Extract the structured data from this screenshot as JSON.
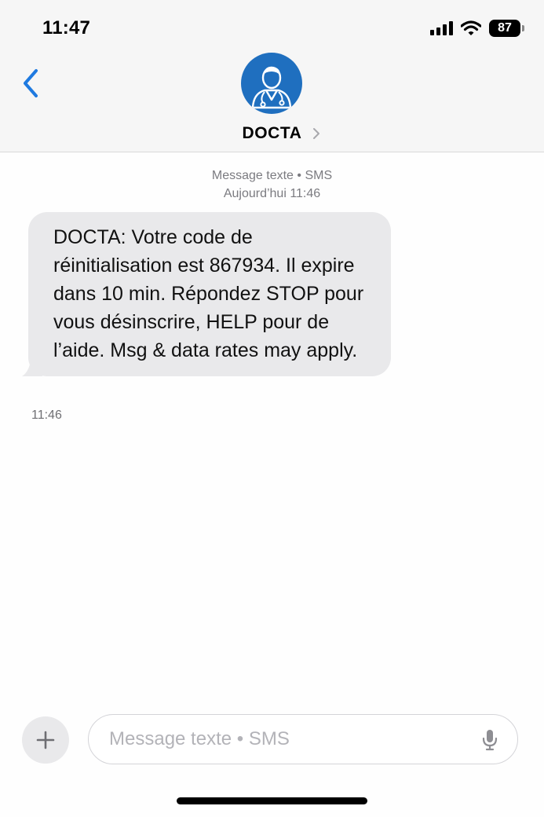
{
  "status_bar": {
    "time": "11:47",
    "battery": "87",
    "icons": [
      "signal-icon",
      "wifi-icon",
      "battery-icon"
    ]
  },
  "header": {
    "back_icon": "chevron-left-icon",
    "avatar_icon": "doctor-icon",
    "contact_name": "DOCTA",
    "details_icon": "chevron-right-icon"
  },
  "thread": {
    "meta_line1": "Message texte • SMS",
    "meta_line2": "Aujourd’hui 11:46",
    "messages": [
      {
        "direction": "incoming",
        "text": "DOCTA: Votre code de réinitialisation est 867934. Il expire dans 10 min. Répondez STOP pour vous désinscrire, HELP pour de l’aide. Msg & data rates may apply.",
        "time": "11:46"
      }
    ]
  },
  "composer": {
    "plus_icon": "plus-icon",
    "placeholder": "Message texte • SMS",
    "value": "",
    "mic_icon": "microphone-icon"
  },
  "colors": {
    "accent": "#1f7ae0",
    "avatar_bg": "#1f6fbf",
    "bubble_incoming": "#e9e9eb",
    "header_bg": "#f6f6f6"
  }
}
